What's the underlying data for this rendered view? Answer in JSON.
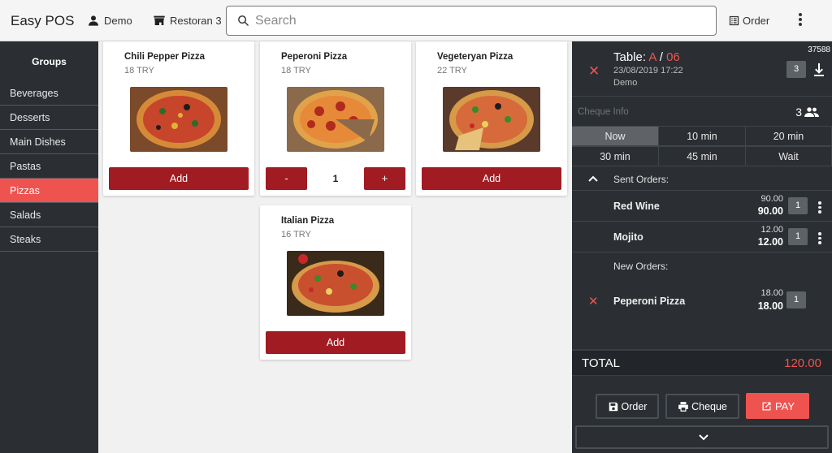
{
  "header": {
    "brand": "Easy POS",
    "user": "Demo",
    "restaurant": "Restoran 3",
    "search_placeholder": "Search",
    "order_label": "Order"
  },
  "sidebar": {
    "title": "Groups",
    "items": [
      {
        "label": "Beverages",
        "active": false
      },
      {
        "label": "Desserts",
        "active": false
      },
      {
        "label": "Main Dishes",
        "active": false
      },
      {
        "label": "Pastas",
        "active": false
      },
      {
        "label": "Pizzas",
        "active": true
      },
      {
        "label": "Salads",
        "active": false
      },
      {
        "label": "Steaks",
        "active": false
      }
    ]
  },
  "products": [
    {
      "name": "Chili Pepper Pizza",
      "price": "18 TRY",
      "button": "Add"
    },
    {
      "name": "Peperoni Pizza",
      "price": "18 TRY",
      "minus": "-",
      "qty": "1",
      "plus": "+"
    },
    {
      "name": "Vegeteryan Pizza",
      "price": "22 TRY",
      "button": "Add"
    },
    {
      "name": "Italian Pizza",
      "price": "16 TRY",
      "button": "Add"
    }
  ],
  "order_panel": {
    "table_prefix": "Table:",
    "table_section": "A",
    "table_sep": "/",
    "table_number": "06",
    "date": "23/08/2019 17:22",
    "user": "Demo",
    "cheque_no": "37588",
    "count_box": "3",
    "cheque_info_label": "Cheque Info",
    "guests": "3",
    "times": [
      "Now",
      "10 min",
      "20 min",
      "30 min",
      "45 min",
      "Wait"
    ],
    "sent_label": "Sent Orders:",
    "sent_orders": [
      {
        "name": "Red Wine",
        "unit": "90.00",
        "total": "90.00",
        "qty": "1"
      },
      {
        "name": "Mojito",
        "unit": "12.00",
        "total": "12.00",
        "qty": "1"
      }
    ],
    "new_label": "New Orders:",
    "new_orders": [
      {
        "name": "Peperoni Pizza",
        "unit": "18.00",
        "total": "18.00",
        "qty": "1"
      }
    ],
    "total_label": "TOTAL",
    "total_value": "120.00",
    "order_btn": "Order",
    "cheque_btn": "Cheque",
    "pay_btn": "PAY"
  },
  "colors": {
    "accent": "#ef5350",
    "button": "#a01c22",
    "panel": "#2b2f33"
  }
}
